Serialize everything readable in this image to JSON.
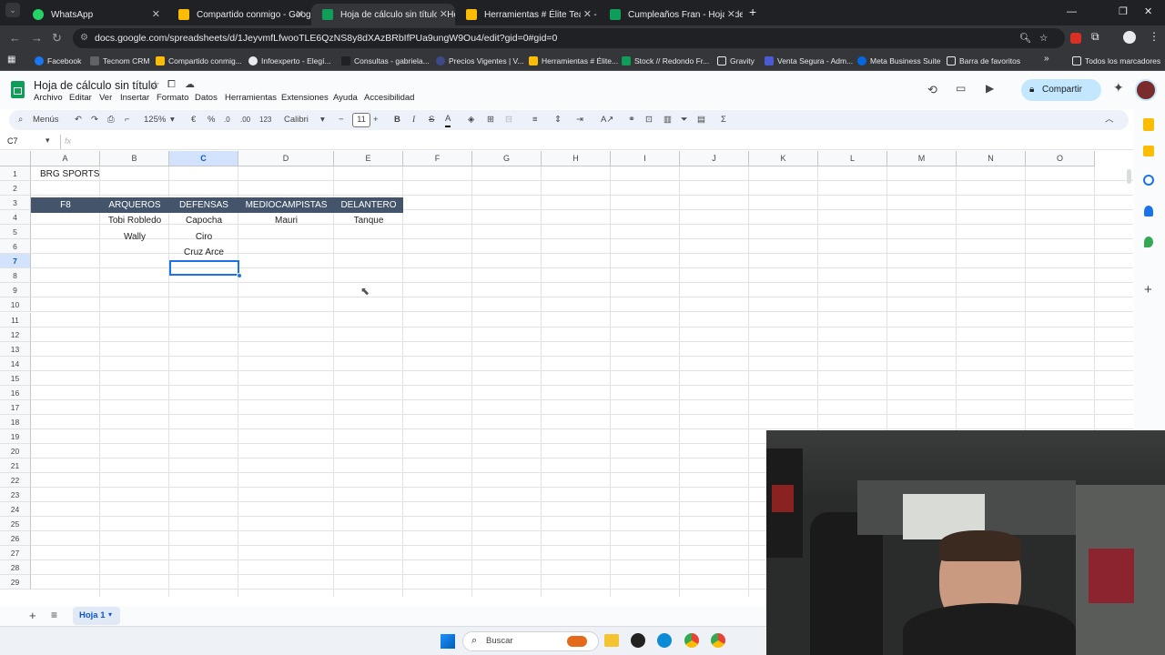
{
  "browser": {
    "tabs": [
      {
        "label": "WhatsApp",
        "color": "#25d366"
      },
      {
        "label": "Compartido conmigo - Google",
        "color": "#fbbc04"
      },
      {
        "label": "Hoja de cálculo sin título - Hoja",
        "color": "#0f9d58"
      },
      {
        "label": "Herramientas # Élite Team - Go",
        "color": "#fbbc04"
      },
      {
        "label": "Cumpleaños Fran - Hojas de cá",
        "color": "#0f9d58"
      }
    ],
    "new_tab": "+",
    "url": "docs.google.com/spreadsheets/d/1JeyvmfLfwooTLE6QzNS8y8dXAzBRbIfPUa9ungW9Ou4/edit?gid=0#gid=0",
    "bookmarks": [
      "Facebook",
      "Tecnom CRM",
      "Compartido conmig...",
      "Infoexperto - Elegí...",
      "Consultas - gabriela...",
      "Precios Vigentes | V...",
      "Herramientas # Élite...",
      "Stock // Redondo Fr...",
      "Gravity",
      "Venta Segura - Adm...",
      "Meta Business Suite",
      "Barra de favoritos"
    ],
    "all_bookmarks": "Todos los marcadores"
  },
  "sheets": {
    "title": "Hoja de cálculo sin título",
    "menus": [
      "Archivo",
      "Editar",
      "Ver",
      "Insertar",
      "Formato",
      "Datos",
      "Herramientas",
      "Extensiones",
      "Ayuda",
      "Accesibilidad"
    ],
    "share_label": "Compartir",
    "toolbar": {
      "menus_label": "Menús",
      "zoom": "125%",
      "currency": "€",
      "percent": "%",
      "dec_less": ".0",
      "dec_more": ".00",
      "number_fmt": "123",
      "font": "Calibri",
      "font_size": "11",
      "bold": "B",
      "italic": "I",
      "strike": "S",
      "text_color": "A",
      "sum": "Σ"
    },
    "name_box": "C7",
    "fx": "fx",
    "columns": [
      "A",
      "B",
      "C",
      "D",
      "E",
      "F",
      "G",
      "H",
      "I",
      "J",
      "K",
      "L",
      "M",
      "N",
      "O"
    ],
    "rows": [
      "1",
      "2",
      "3",
      "4",
      "5",
      "6",
      "7",
      "8",
      "9",
      "10",
      "11",
      "12",
      "13",
      "14",
      "15",
      "16",
      "17",
      "18",
      "19",
      "20",
      "21",
      "22",
      "23",
      "24",
      "25",
      "26",
      "27",
      "28",
      "29"
    ],
    "cells": {
      "A1": "BRG SPORTS",
      "A3": "F8",
      "B3": "ARQUEROS",
      "C3": "DEFENSAS",
      "D3": "MEDIOCAMPISTAS",
      "E3": "DELANTERO",
      "B4": "Tobi Robledo",
      "C4": "Capocha",
      "D4": "Mauri",
      "E4": "Tanque",
      "B5": "Wally",
      "C5": "Ciro",
      "C6": "Cruz Arce"
    },
    "header_fill": "#44546a",
    "sheet_tab": "Hoja 1"
  },
  "taskbar": {
    "search_placeholder": "Buscar"
  }
}
